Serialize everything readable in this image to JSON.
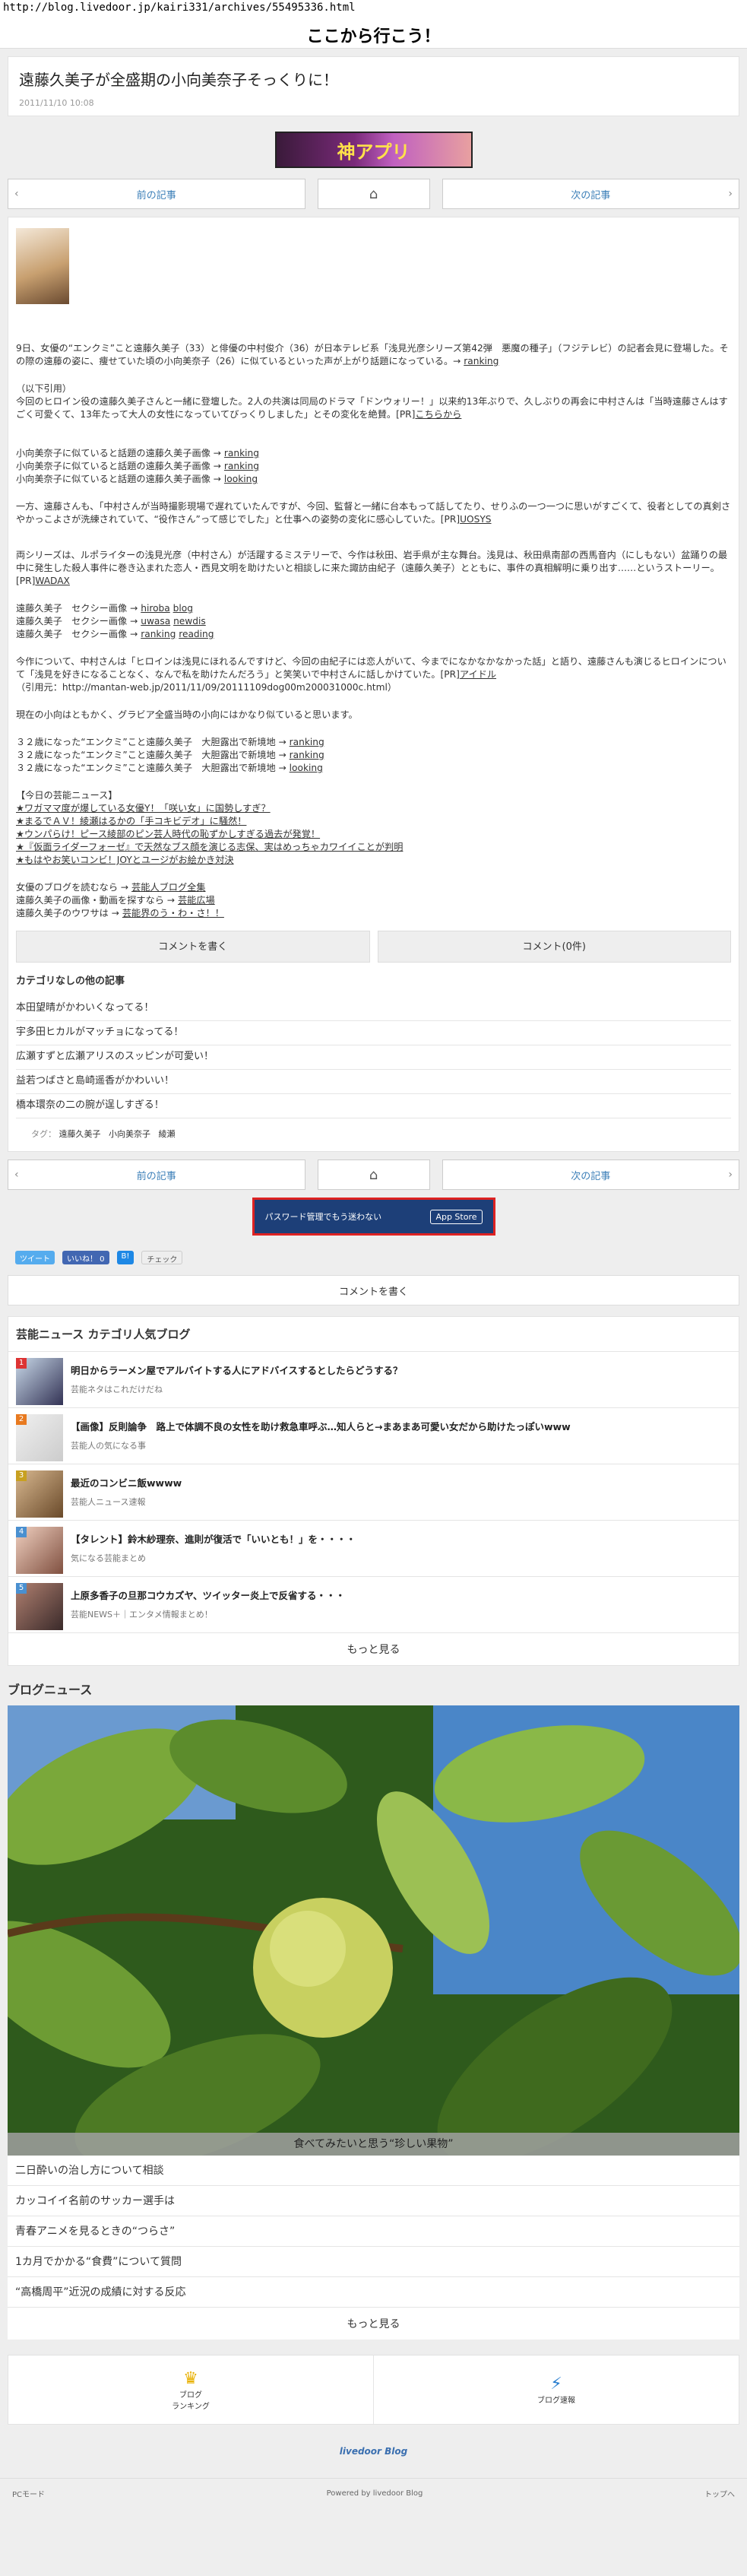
{
  "url": "http://blog.livedoor.jp/kairi331/archives/55495336.html",
  "site_title": "ここから行こう！",
  "article": {
    "title": "遠藤久美子が全盛期の小向美奈子そっくりに！",
    "date": "2011/11/10 10:08"
  },
  "ad1": {
    "text": "神アプリ"
  },
  "pager": {
    "prev": "前の記事",
    "next": "次の記事"
  },
  "body": {
    "p1": "9日、女優の“エンクミ”こと遠藤久美子（33）と俳優の中村俊介（36）が日本テレビ系「浅見光彦シリーズ第42弾　悪魔の種子」（フジテレビ）の記者会見に登場した。その際の遠藤の姿に、痩せていた頃の小向美奈子（26）に似ているといった声が上がり話題になっている。→",
    "p1_link": "ranking",
    "p2": "（以下引用）\n今回のヒロイン役の遠藤久美子さんと一緒に登壇した。2人の共演は同局のドラマ「ドンウォリー！」以来約13年ぶりで、久しぶりの再会に中村さんは「当時遠藤さんはすごく可愛くて、13年たって大人の女性になっていてびっくりしました」とその変化を絶賛。[PR]",
    "p2_link": "こちらから",
    "l1": "小向美奈子に似ていると話題の遠藤久美子画像 →",
    "l1a": "ranking",
    "l2": "小向美奈子に似ていると話題の遠藤久美子画像 →",
    "l2a": "ranking",
    "l3": "小向美奈子に似ていると話題の遠藤久美子画像 →",
    "l3a": "looking",
    "p3": "一方、遠藤さんも、「中村さんが当時撮影現場で遅れていたんですが、今回、監督と一緒に台本もって話してたり、せりふの一つ一つに思いがすごくて、役者としての真剣さやかっこよさが洗練されていて、“役作さん”って感じでした」と仕事への姿勢の変化に感心していた。[PR]",
    "p3_link": "UOSYS",
    "p4": "両シリーズは、ルポライターの浅見光彦（中村さん）が活躍するミステリーで、今作は秋田、岩手県が主な舞台。浅見は、秋田県南部の西馬音内（にしもない）盆踊りの最中に発生した殺人事件に巻き込まれた恋人・西見文明を助けたいと相談しに来た諏訪由紀子（遠藤久美子）とともに、事件の真相解明に乗り出す……というストーリー。[PR]",
    "p4_link": "WADAX",
    "s1": "遠藤久美子　セクシー画像 →",
    "s1a": "hiroba",
    "s1b": "blog",
    "s2": "遠藤久美子　セクシー画像 →",
    "s2a": "uwasa",
    "s2b": "newdis",
    "s3": "遠藤久美子　セクシー画像 →",
    "s3a": "ranking",
    "s3b": "reading",
    "p5": "今作について、中村さんは「ヒロインは浅見にほれるんですけど、今回の由紀子には恋人がいて、今までになかなかなかった話」と語り、遠藤さんも演じるヒロインについて「浅見を好きになることなく、なんで私を助けたんだろう」と笑笑いで中村さんに話しかけていた。[PR]",
    "p5_link": "アイドル",
    "p5_src": "（引用元：http://mantan-web.jp/2011/11/09/20111109dog00m200031000c.html）",
    "p6": "現在の小向はともかく、グラビア全盛当時の小向にはかなり似ていると思います。",
    "n1": "３２歳になった“エンクミ”こと遠藤久美子　大胆露出で新境地 →",
    "n1a": "ranking",
    "n2": "３２歳になった“エンクミ”こと遠藤久美子　大胆露出で新境地 →",
    "n2a": "ranking",
    "n3": "３２歳になった“エンクミ”こと遠藤久美子　大胆露出で新境地 →",
    "n3a": "looking",
    "hot_title": "【今日の芸能ニュース】",
    "hot": [
      "★ワガママ度が爆している女優Y！「咲い女」に国勢しすぎ？",
      "★まるでＡＶ！綾瀬はるかの「手コキビデオ」に騒然！",
      "★ウンパらけ！ピース綾部のピン芸人時代の恥ずかしすぎる過去が発覚！",
      "★『仮面ライダーフォーゼ』で天然なブス顔を演じる志保、実はめっちゃカワイイことが判明",
      "★もはやお笑いコンビ！JOYとユージがお絵かき対決"
    ],
    "f1": "女優のブログを読むなら →",
    "f1a": "芸能人ブログ全集",
    "f2": "遠藤久美子の画像・動画を探すなら →",
    "f2a": "芸能広場",
    "f3": "遠藤久美子のウワサは →",
    "f3a": "芸能界のう・わ・さ！！"
  },
  "buttons": {
    "comment": "コメントを書く",
    "comment_count": "コメント(0件)"
  },
  "category": {
    "title": "カテゴリなしの他の記事",
    "items": [
      "本田望晴がかわいくなってる！",
      "宇多田ヒカルがマッチョになってる！",
      "広瀬すずと広瀬アリスのスッピンが可愛い！",
      "益若つばさと島崎遥香がかわいい！",
      "橋本環奈の二の腕が逞しすぎる！"
    ]
  },
  "tags": {
    "label": "タグ：",
    "items": [
      "遠藤久美子",
      "小向美奈子",
      "綾瀬"
    ]
  },
  "ad2": {
    "text": "パスワード管理でもう迷わない",
    "store": "App Store"
  },
  "share": {
    "tweet": "ツイート",
    "like": "いいね！ 0",
    "b": "B!",
    "check": "チェック"
  },
  "comment_bar": "コメントを書く",
  "ranking": {
    "title": "芸能ニュース カテゴリ人気ブログ",
    "items": [
      {
        "num": "1",
        "title": "明日からラーメン屋でアルバイトする人にアドバイスするとしたらどうする？",
        "sub": "芸能ネタはこれだけだね"
      },
      {
        "num": "2",
        "title": "【画像】反則論争　路上で体調不良の女性を助け救急車呼ぶ…知人らと→まあまあ可愛い女だから助けたっぽいwww",
        "sub": "芸能人の気になる事"
      },
      {
        "num": "3",
        "title": "最近のコンビニ飯wwww",
        "sub": "芸能人ニュース速報"
      },
      {
        "num": "4",
        "title": "【タレント】鈴木紗理奈、進則が復活で「いいとも！」を・・・・",
        "sub": "気になる芸能まとめ"
      },
      {
        "num": "5",
        "title": "上原多香子の旦那コウカズヤ、ツイッター炎上で反省する・・・",
        "sub": "芸能NEWS＋｜エンタメ情報まとめ！"
      }
    ],
    "more": "もっと見る"
  },
  "news": {
    "title": "ブログニュース",
    "caption": "食べてみたいと思う“珍しい果物”",
    "items": [
      "二日酔いの治し方について相談",
      "カッコイイ名前のサッカー選手は",
      "青春アニメを見るときの“つらさ”",
      "1カ月でかかる“食費”について質問",
      "“高橋周平”近況の成績に対する反応"
    ],
    "more": "もっと見る"
  },
  "nav": {
    "ranking": "ブログ\nランキング",
    "speed": "ブログ速報"
  },
  "logo": "livedoor Blog",
  "footer": {
    "pc": "PCモード",
    "powered": "Powered by livedoor Blog",
    "top": "トップへ"
  }
}
